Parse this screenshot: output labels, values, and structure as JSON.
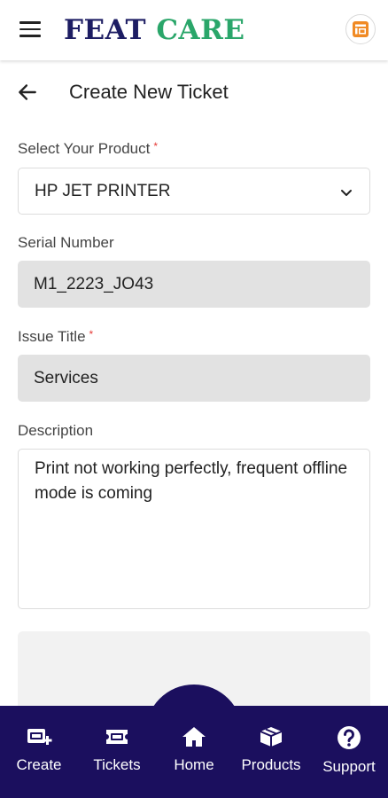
{
  "header": {
    "logo_part1": "FEAT",
    "logo_part2": "CARE"
  },
  "page": {
    "title": "Create New Ticket"
  },
  "form": {
    "product": {
      "label": "Select Your Product",
      "required_mark": "*",
      "value": "HP JET PRINTER"
    },
    "serial": {
      "label": "Serial Number",
      "value": "M1_2223_JO43"
    },
    "issue": {
      "label": "Issue Title",
      "required_mark": "*",
      "value": "Services"
    },
    "description": {
      "label": "Description",
      "value": "Print not working perfectly, frequent offline mode is coming"
    }
  },
  "nav": {
    "items": [
      {
        "label": "Create",
        "icon": "create-ticket-icon"
      },
      {
        "label": "Tickets",
        "icon": "ticket-icon"
      },
      {
        "label": "Home",
        "icon": "home-icon"
      },
      {
        "label": "Products",
        "icon": "box-icon"
      },
      {
        "label": "Support",
        "icon": "help-icon"
      }
    ]
  },
  "colors": {
    "brand_navy": "#1b0f5e",
    "logo_navy": "#1d1d63",
    "logo_green": "#2aa66a",
    "required_red": "#e53935",
    "filled_field_bg": "#e2e2e2"
  }
}
